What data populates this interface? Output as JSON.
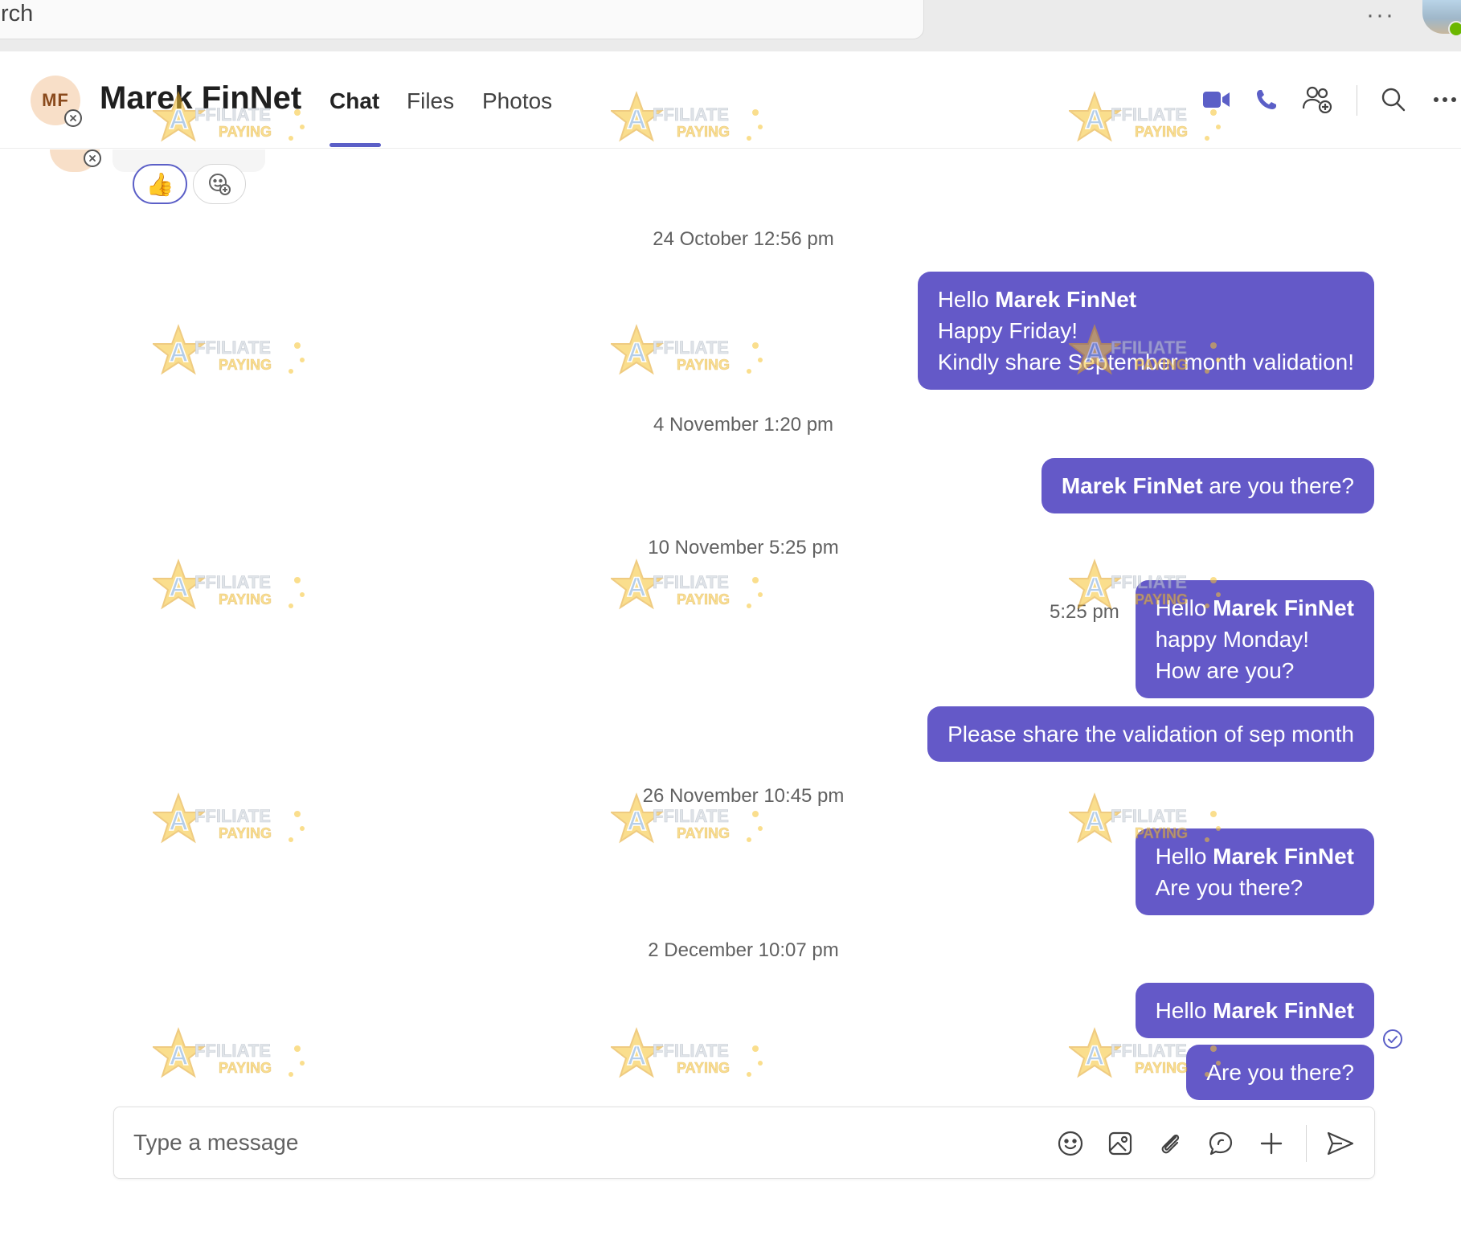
{
  "top_bar": {
    "search_text": "rch",
    "more_label": "···"
  },
  "chat": {
    "avatar_initials": "MF",
    "name": "Marek FinNet",
    "tabs": [
      {
        "label": "Chat",
        "active": true
      },
      {
        "label": "Files",
        "active": false
      },
      {
        "label": "Photos",
        "active": false
      }
    ],
    "header_icons": [
      "video-call-icon",
      "audio-call-icon",
      "add-people-icon",
      "search-icon",
      "more-options-icon"
    ],
    "more_label": "···"
  },
  "previous_message": {
    "reaction_emoji": "👍"
  },
  "timeline": [
    {
      "type": "timestamp",
      "text": "24 October 12:56 pm"
    },
    {
      "type": "message",
      "lines": [
        [
          {
            "text": "Hello "
          },
          {
            "text": "Marek FinNet",
            "bold": true
          }
        ],
        [
          {
            "text": "Happy Friday!"
          }
        ],
        [
          {
            "text": "Kindly share September month validation!"
          }
        ]
      ]
    },
    {
      "type": "timestamp",
      "text": "4 November 1:20 pm"
    },
    {
      "type": "message",
      "lines": [
        [
          {
            "text": "Marek FinNet",
            "bold": true
          },
          {
            "text": " are you there?"
          }
        ]
      ]
    },
    {
      "type": "timestamp",
      "text": "10 November 5:25 pm"
    },
    {
      "type": "message",
      "time": "5:25 pm",
      "lines": [
        [
          {
            "text": "Hello "
          },
          {
            "text": "Marek FinNet",
            "bold": true
          }
        ],
        [
          {
            "text": "happy Monday!"
          }
        ],
        [
          {
            "text": "How are you?"
          }
        ]
      ]
    },
    {
      "type": "message",
      "lines": [
        [
          {
            "text": "Please share the validation of sep month"
          }
        ]
      ]
    },
    {
      "type": "timestamp",
      "text": "26 November 10:45 pm"
    },
    {
      "type": "message",
      "lines": [
        [
          {
            "text": "Hello "
          },
          {
            "text": "Marek FinNet",
            "bold": true
          }
        ],
        [
          {
            "text": "Are you there?"
          }
        ]
      ]
    },
    {
      "type": "timestamp",
      "text": "2 December 10:07 pm"
    },
    {
      "type": "message",
      "lines": [
        [
          {
            "text": "Hello "
          },
          {
            "text": "Marek FinNet",
            "bold": true
          }
        ]
      ]
    },
    {
      "type": "message",
      "lines": [
        [
          {
            "text": "Are you there?"
          }
        ]
      ]
    }
  ],
  "composer": {
    "placeholder": "Type a message",
    "icons": [
      "emoji-icon",
      "image-icon",
      "attach-icon",
      "loop-icon",
      "plus-icon",
      "send-icon"
    ]
  },
  "watermark": {
    "line1": "AFFILIATE",
    "line2": "PAYING"
  },
  "colors": {
    "accent": "#5b5fc7",
    "bubble": "#6459c8",
    "avatar_bg": "#f8dfc8"
  }
}
